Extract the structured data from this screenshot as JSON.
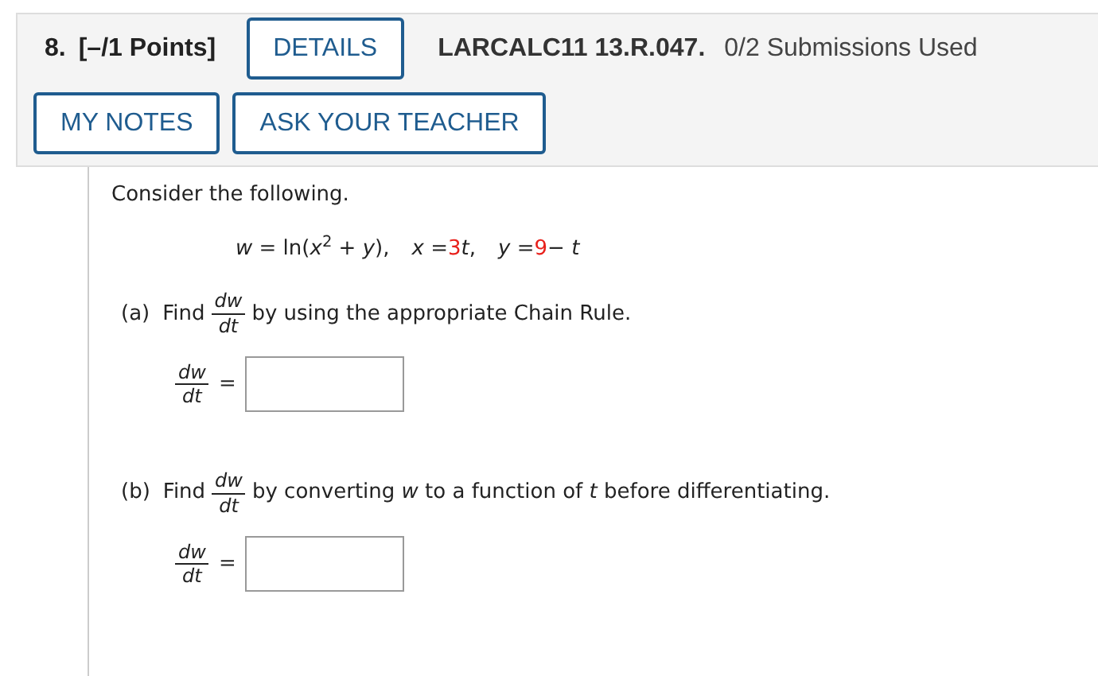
{
  "header": {
    "number": "8.",
    "points": "[–/1 Points]",
    "details_button": "DETAILS",
    "problem_code": "LARCALC11 13.R.047.",
    "submissions": "0/2 Submissions Used",
    "buttons": [
      "MY NOTES",
      "ASK YOUR TEACHER"
    ]
  },
  "intro": "Consider the following.",
  "equation": [
    {
      "text": "*w* = ln(*x*$^{2}$ + *y*),",
      "color": "#222222"
    },
    {
      "text": "*x* =",
      "color": "#222222"
    },
    {
      "text": "3",
      "color": "#e8201b"
    },
    {
      "text": "*t*,",
      "color": "#222222"
    },
    {
      "text": "*y* =",
      "color": "#222222"
    },
    {
      "text": "9",
      "color": "#e8201b"
    },
    {
      "text": "− *t*",
      "color": "#222222"
    }
  ],
  "parts": [
    {
      "label": "(a)",
      "find": "Find",
      "numerator": "dw",
      "denominator": "dt",
      "rest": "by using the appropriate Chain Rule.",
      "answer": {
        "numerator": "dw",
        "denominator": "dt",
        "equals": "="
      }
    },
    {
      "label": "(b)",
      "find": "Find",
      "numerator": "dw",
      "denominator": "dt",
      "rest": "by converting *w* to a function of *t* before differentiating.",
      "answer": {
        "numerator": "dw",
        "denominator": "dt",
        "equals": "="
      }
    }
  ]
}
